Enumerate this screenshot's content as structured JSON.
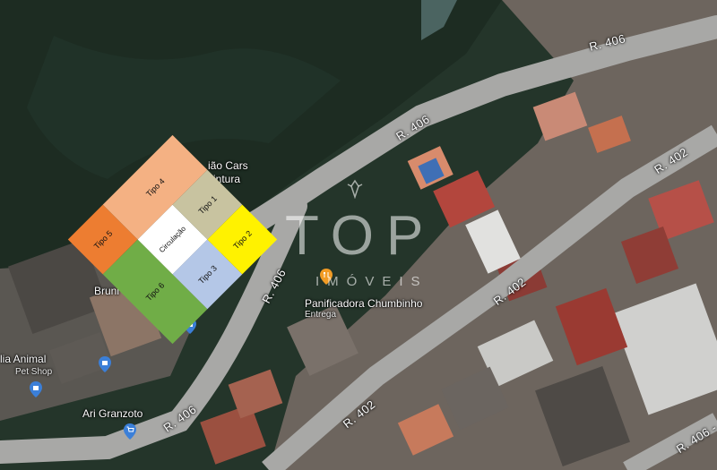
{
  "map": {
    "road_labels": [
      "R. 406",
      "R. 406",
      "R. 406",
      "R. 406",
      "R. 402",
      "R. 402",
      "R. 402",
      "R. 406 -"
    ],
    "place_labels": {
      "cars_line1": "ião Cars",
      "cars_line2": "intura",
      "bruni": "Bruni",
      "pet_name": "lia Animal",
      "pet_category": "Pet Shop",
      "ari": "Ari Granzoto",
      "bakery": "Panificadora Chumbinho",
      "bakery_sub": "Entrega"
    },
    "pins": {
      "bakery": "fork-knife-pin-icon",
      "pet": "shopping-bag-pin-icon",
      "ari": "cart-pin-icon"
    }
  },
  "floor_plan": {
    "circulation": "Circulação",
    "types": {
      "tipo1": {
        "label": "Tipo 1",
        "color": "#c8c3a0"
      },
      "tipo2": {
        "label": "Tipo 2",
        "color": "#fff200"
      },
      "tipo3": {
        "label": "Tipo 3",
        "color": "#b4c7e7"
      },
      "tipo4": {
        "label": "Tipo 4",
        "color": "#f4b183"
      },
      "tipo5": {
        "label": "Tipo 5",
        "color": "#ed7d31"
      },
      "tipo6": {
        "label": "Tipo 6",
        "color": "#70ad47"
      }
    },
    "circulation_color": "#ffffff"
  },
  "watermark": {
    "brand": "TOP",
    "tagline": "IMÓVEIS"
  }
}
